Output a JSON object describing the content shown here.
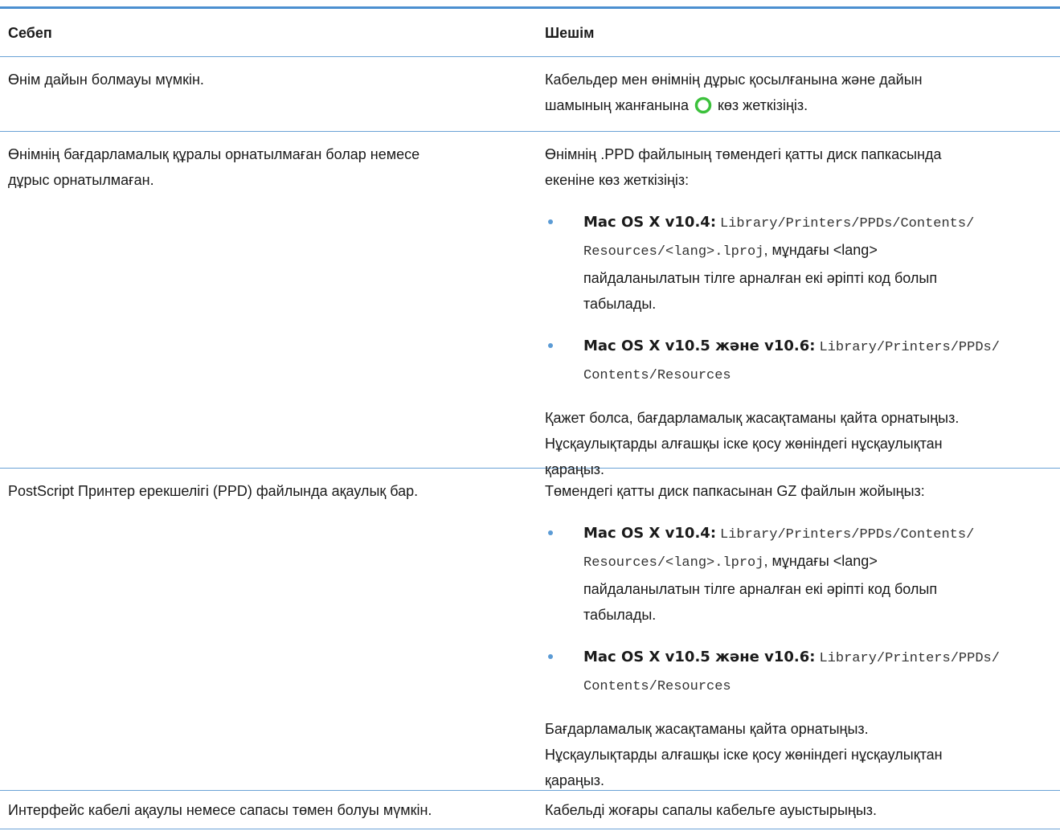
{
  "header": {
    "col1": "Себеп",
    "col2": "Шешім"
  },
  "rows": [
    {
      "cause": "Өнім дайын болмауы мүмкін.",
      "solution_a": "Кабельдер мен өнімнің дұрыс қосылғанына және дайын",
      "solution_b": "шамының жанғанына",
      "solution_c": "көз жеткізіңіз."
    },
    {
      "cause_line1": "Өнімнің бағдарламалық құралы орнатылмаған болар немесе",
      "cause_line2": "дұрыс орнатылмаған.",
      "intro_line1": "Өнімнің .PPD файлының төмендегі қатты диск папкасында",
      "intro_line2": "екеніне көз жеткізіңіз:",
      "bullet1": {
        "os": "Mac OS X v10.4:",
        "path1": "Library/Printers/PPDs/Contents/",
        "path2": "Resources/<lang>.lproj",
        "text_a": ", мұндағы <lang>",
        "text_b": "пайдаланылатын тілге арналған екі әріпті код болып",
        "text_c": "табылады."
      },
      "bullet2": {
        "os": "Mac OS X v10.5 және v10.6:",
        "path1": "Library/Printers/PPDs/",
        "path2": "Contents/Resources"
      },
      "outro_line1": "Қажет болса, бағдарламалық жасақтаманы қайта орнатыңыз.",
      "outro_line2": "Нұсқаулықтарды алғашқы іске қосу жөніндегі нұсқаулықтан",
      "outro_line3": "қараңыз."
    },
    {
      "cause": "PostScript Принтер ерекшелігі (PPD) файлында ақаулық бар.",
      "intro": "Төмендегі қатты диск папкасынан GZ файлын жойыңыз:",
      "bullet1": {
        "os": "Mac OS X v10.4:",
        "path1": "Library/Printers/PPDs/Contents/",
        "path2": "Resources/<lang>.lproj",
        "text_a": ", мұндағы <lang>",
        "text_b": "пайдаланылатын тілге арналған екі әріпті код болып",
        "text_c": "табылады."
      },
      "bullet2": {
        "os": "Mac OS X v10.5 және v10.6:",
        "path1": "Library/Printers/PPDs/",
        "path2": "Contents/Resources"
      },
      "outro_line1": "Бағдарламалық жасақтаманы қайта орнатыңыз.",
      "outro_line2": "Нұсқаулықтарды алғашқы іске қосу жөніндегі нұсқаулықтан",
      "outro_line3": "қараңыз."
    },
    {
      "cause": "Интерфейс кабелі ақаулы немесе сапасы төмен болуы мүмкін.",
      "solution": "Кабельді жоғары сапалы кабельге ауыстырыңыз."
    }
  ],
  "icons": {
    "ready_light": "ready-light-icon"
  },
  "colors": {
    "accent_rule": "#4b8fd0",
    "row_rule": "#6aa2d6",
    "bullet": "#5b9bd5",
    "ready_light": "#3cc13c"
  }
}
